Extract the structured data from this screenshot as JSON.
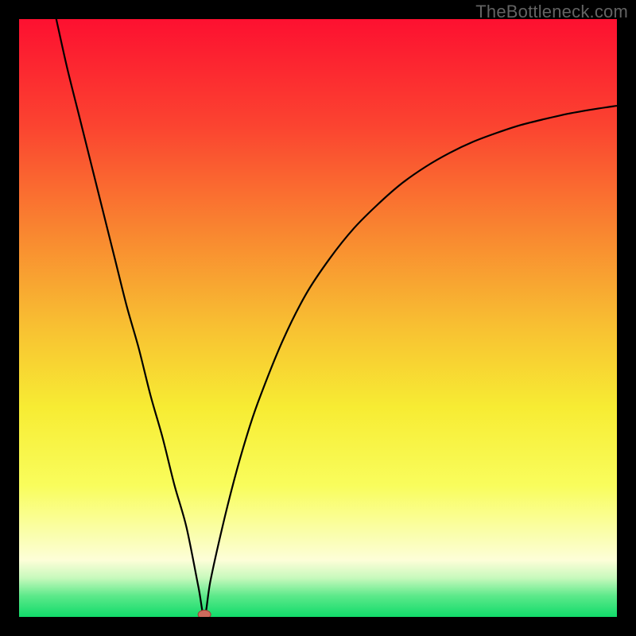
{
  "attribution": "TheBottleneck.com",
  "colors": {
    "frame": "#000000",
    "curve": "#000000",
    "marker_fill": "#ce6b5d",
    "marker_stroke": "#9c3e34",
    "gradient_stops": [
      {
        "offset": 0.0,
        "color": "#fd1030"
      },
      {
        "offset": 0.18,
        "color": "#fb4430"
      },
      {
        "offset": 0.35,
        "color": "#f98430"
      },
      {
        "offset": 0.52,
        "color": "#f8c232"
      },
      {
        "offset": 0.65,
        "color": "#f7ec33"
      },
      {
        "offset": 0.78,
        "color": "#f9fd5c"
      },
      {
        "offset": 0.86,
        "color": "#fafeab"
      },
      {
        "offset": 0.905,
        "color": "#fdfed8"
      },
      {
        "offset": 0.935,
        "color": "#c7f9bc"
      },
      {
        "offset": 0.965,
        "color": "#5ce98a"
      },
      {
        "offset": 1.0,
        "color": "#11db6a"
      }
    ]
  },
  "chart_data": {
    "type": "line",
    "title": "",
    "xlabel": "",
    "ylabel": "",
    "xlim": [
      0,
      100
    ],
    "ylim": [
      0,
      100
    ],
    "grid": false,
    "legend": false,
    "annotations": [],
    "marker": {
      "x": 31,
      "y": 0
    },
    "series": [
      {
        "name": "bottleneck-curve",
        "x": [
          4,
          6,
          8,
          10,
          12,
          14,
          16,
          18,
          20,
          22,
          24,
          26,
          28,
          30,
          31,
          32,
          34,
          36,
          38,
          40,
          44,
          48,
          52,
          56,
          60,
          64,
          68,
          72,
          76,
          80,
          84,
          88,
          92,
          96,
          100
        ],
        "y": [
          110,
          101,
          92,
          84,
          76,
          68,
          60,
          52,
          45,
          37,
          30,
          22,
          15,
          5,
          0,
          6,
          15,
          23,
          30,
          36,
          46,
          54,
          60,
          65,
          69,
          72.5,
          75.3,
          77.6,
          79.5,
          81,
          82.3,
          83.3,
          84.2,
          84.9,
          85.5
        ]
      }
    ]
  }
}
